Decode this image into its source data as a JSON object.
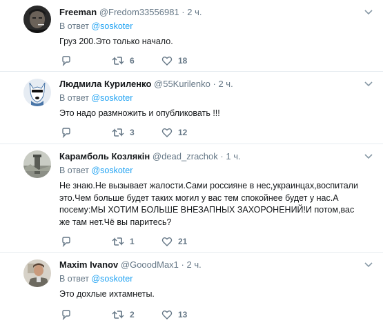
{
  "tweets": [
    {
      "name": "Freeman",
      "handle": "@Fredom33556981",
      "separator": "·",
      "time": "2 ч.",
      "reply_prefix": "В ответ",
      "reply_to": "@soskoter",
      "text": "Груз 200.Это только начало.",
      "replies": "",
      "retweets": "6",
      "likes": "18",
      "avatar": "dark-portrait"
    },
    {
      "name": "Людмила Куриленко",
      "handle": "@55Kurilenko",
      "separator": "·",
      "time": "2 ч.",
      "reply_prefix": "В ответ",
      "reply_to": "@soskoter",
      "text": "Это надо размножить и опубликовать !!!",
      "replies": "",
      "retweets": "3",
      "likes": "12",
      "avatar": "vk-logo"
    },
    {
      "name": "Карамболь Козлякін",
      "handle": "@dead_zrachok",
      "separator": "·",
      "time": "1 ч.",
      "reply_prefix": "В ответ",
      "reply_to": "@soskoter",
      "text": "Не знаю.Не вызывает жалости.Сами россияне в нес,украинцах,воспитали это.Чем больше будет таких могил у вас тем спокойнее будет у нас.А посему:МЫ ХОТИМ БОЛЬШЕ ВНЕЗАПНЫХ ЗАХОРОНЕНИЙ!И потом,вас же там нет.Чё вы паритесь?",
      "replies": "",
      "retweets": "1",
      "likes": "21",
      "avatar": "grey-landscape"
    },
    {
      "name": "Maxim Ivanov",
      "handle": "@GooodMax1",
      "separator": "·",
      "time": "2 ч.",
      "reply_prefix": "В ответ",
      "reply_to": "@soskoter",
      "text": "Это дохлые ихтамнеты.",
      "replies": "",
      "retweets": "2",
      "likes": "13",
      "avatar": "man-portrait"
    }
  ],
  "colors": {
    "name": "#14171a",
    "meta": "#657786",
    "link": "#1da1f2",
    "divider": "#e6ecf0"
  }
}
